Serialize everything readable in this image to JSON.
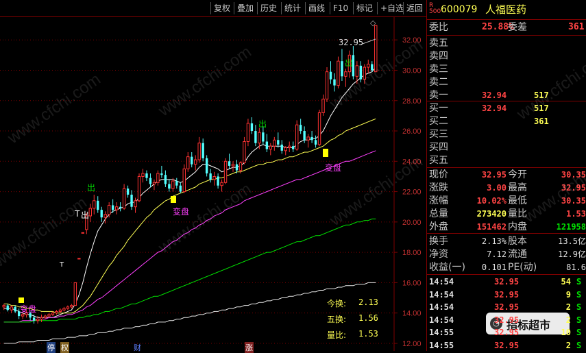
{
  "toolbar": {
    "buttons": [
      "复权",
      "叠加",
      "历史",
      "统计",
      "画线",
      "F10",
      "标记",
      "+自选",
      "返回"
    ]
  },
  "chart": {
    "y_ticks": [
      "32.00",
      "30.00",
      "28.00",
      "26.00",
      "24.00",
      "22.00",
      "20.00",
      "18.00",
      "16.00",
      "14.00",
      "12.00"
    ],
    "high_label": "32.95",
    "markers": {
      "chu1": "出",
      "chu2": "出",
      "chu3": "出",
      "chu4": "出",
      "biandian1": "变盘",
      "biandian2": "变盘",
      "biandian3": "变盘",
      "t_mark": "T"
    },
    "bottom_stats": {
      "jinhuan_label": "今换:",
      "jinhuan_value": "2.13",
      "wuhuan_label": "五换:",
      "wuhuan_value": "1.56",
      "liangbi_label": "量比:",
      "liangbi_value": "1.53"
    },
    "bottom_flags": [
      "停",
      "权",
      "财",
      "涨"
    ],
    "watermark": "www.cfchi.com"
  },
  "chart_data": {
    "type": "candlestick",
    "ylim": [
      11.5,
      33.5
    ],
    "candles": [
      [
        14.4,
        14.6,
        14.2,
        14.5
      ],
      [
        14.5,
        14.6,
        14.1,
        14.2
      ],
      [
        14.2,
        14.5,
        14.0,
        14.4
      ],
      [
        14.4,
        14.5,
        14.0,
        14.1
      ],
      [
        14.1,
        14.3,
        13.6,
        13.8
      ],
      [
        13.8,
        14.0,
        13.6,
        13.9
      ],
      [
        13.9,
        14.2,
        13.7,
        14.0
      ],
      [
        14.0,
        14.1,
        13.5,
        13.7
      ],
      [
        13.7,
        13.9,
        13.3,
        13.5
      ],
      [
        13.5,
        13.8,
        13.3,
        13.6
      ],
      [
        13.6,
        13.9,
        13.4,
        13.7
      ],
      [
        13.7,
        13.9,
        13.6,
        13.8
      ],
      [
        13.8,
        14.0,
        13.7,
        13.9
      ],
      [
        13.9,
        14.1,
        13.8,
        14.0
      ],
      [
        14.0,
        14.2,
        13.9,
        14.1
      ],
      [
        14.1,
        14.3,
        14.0,
        14.2
      ],
      [
        14.2,
        14.4,
        14.1,
        14.3
      ],
      [
        14.3,
        14.5,
        14.2,
        14.4
      ],
      [
        14.4,
        14.6,
        14.3,
        14.5
      ],
      [
        14.5,
        16.0,
        14.5,
        16.0
      ],
      [
        17.6,
        17.6,
        17.6,
        17.6
      ],
      [
        19.3,
        19.3,
        19.3,
        19.3
      ],
      [
        19.5,
        20.6,
        19.2,
        20.4
      ],
      [
        20.4,
        21.2,
        20.0,
        20.9
      ],
      [
        20.9,
        21.8,
        20.5,
        21.4
      ],
      [
        21.4,
        21.7,
        20.6,
        20.8
      ],
      [
        20.8,
        21.0,
        20.0,
        20.3
      ],
      [
        20.3,
        20.7,
        19.9,
        20.5
      ],
      [
        20.5,
        21.3,
        20.3,
        21.1
      ],
      [
        21.1,
        21.5,
        20.6,
        20.8
      ],
      [
        20.8,
        21.3,
        20.5,
        21.0
      ],
      [
        21.0,
        21.3,
        20.7,
        20.9
      ],
      [
        20.9,
        22.5,
        20.8,
        22.2
      ],
      [
        22.2,
        22.4,
        21.6,
        21.8
      ],
      [
        21.8,
        22.1,
        20.8,
        21.0
      ],
      [
        21.0,
        21.6,
        20.6,
        21.4
      ],
      [
        21.4,
        23.2,
        21.3,
        23.0
      ],
      [
        23.0,
        23.5,
        22.6,
        23.2
      ],
      [
        23.2,
        23.4,
        22.7,
        22.9
      ],
      [
        22.9,
        23.2,
        22.3,
        22.5
      ],
      [
        22.5,
        22.8,
        22.1,
        22.6
      ],
      [
        22.6,
        23.4,
        22.4,
        23.2
      ],
      [
        23.2,
        23.7,
        22.9,
        23.1
      ],
      [
        23.1,
        23.4,
        22.3,
        22.5
      ],
      [
        22.5,
        22.8,
        22.0,
        22.2
      ],
      [
        22.2,
        22.9,
        22.0,
        22.7
      ],
      [
        22.7,
        22.9,
        22.2,
        22.4
      ],
      [
        22.4,
        22.6,
        21.9,
        22.0
      ],
      [
        22.0,
        23.8,
        21.9,
        23.5
      ],
      [
        23.5,
        24.6,
        23.3,
        24.3
      ],
      [
        24.3,
        24.6,
        23.6,
        23.8
      ],
      [
        23.8,
        24.4,
        23.4,
        24.1
      ],
      [
        24.1,
        25.6,
        23.9,
        25.2
      ],
      [
        25.2,
        25.5,
        24.0,
        24.2
      ],
      [
        24.2,
        24.4,
        23.0,
        23.2
      ],
      [
        23.2,
        23.5,
        22.6,
        22.8
      ],
      [
        22.8,
        23.3,
        22.4,
        23.0
      ],
      [
        23.0,
        23.2,
        22.2,
        22.4
      ],
      [
        22.4,
        22.8,
        22.0,
        22.6
      ],
      [
        22.6,
        24.2,
        22.5,
        24.0
      ],
      [
        24.0,
        24.5,
        23.5,
        23.7
      ],
      [
        23.7,
        24.0,
        23.3,
        23.8
      ],
      [
        23.8,
        24.1,
        23.2,
        23.4
      ],
      [
        23.4,
        24.0,
        23.2,
        23.9
      ],
      [
        23.9,
        25.6,
        23.8,
        25.3
      ],
      [
        25.3,
        26.8,
        25.0,
        26.5
      ],
      [
        26.5,
        26.9,
        25.8,
        26.0
      ],
      [
        26.0,
        26.4,
        25.0,
        25.2
      ],
      [
        25.2,
        26.2,
        24.8,
        25.9
      ],
      [
        25.9,
        26.3,
        25.1,
        25.3
      ],
      [
        25.3,
        25.8,
        24.6,
        24.8
      ],
      [
        24.8,
        25.2,
        24.4,
        25.0
      ],
      [
        25.0,
        25.6,
        24.7,
        25.4
      ],
      [
        25.4,
        25.9,
        24.9,
        25.1
      ],
      [
        25.1,
        25.4,
        24.5,
        24.7
      ],
      [
        24.7,
        25.0,
        24.4,
        24.9
      ],
      [
        24.9,
        25.3,
        24.6,
        25.0
      ],
      [
        25.0,
        25.3,
        24.6,
        24.8
      ],
      [
        24.8,
        26.7,
        24.7,
        26.4
      ],
      [
        26.4,
        26.8,
        25.8,
        26.0
      ],
      [
        26.0,
        26.3,
        25.2,
        25.4
      ],
      [
        25.4,
        25.8,
        24.9,
        25.6
      ],
      [
        25.6,
        26.0,
        25.2,
        25.4
      ],
      [
        25.4,
        25.7,
        24.9,
        25.1
      ],
      [
        25.1,
        27.4,
        25.0,
        27.2
      ],
      [
        27.2,
        28.4,
        27.0,
        28.1
      ],
      [
        28.1,
        30.2,
        27.9,
        29.9
      ],
      [
        29.9,
        30.6,
        29.1,
        29.4
      ],
      [
        29.4,
        29.8,
        28.6,
        29.0
      ],
      [
        29.0,
        30.9,
        28.8,
        30.6
      ],
      [
        30.6,
        31.4,
        29.3,
        29.6
      ],
      [
        29.6,
        30.1,
        28.9,
        29.9
      ],
      [
        29.9,
        31.3,
        29.5,
        31.0
      ],
      [
        31.0,
        31.6,
        29.4,
        29.6
      ],
      [
        29.6,
        30.6,
        29.1,
        30.3
      ],
      [
        30.3,
        30.6,
        29.2,
        29.4
      ],
      [
        29.4,
        30.4,
        29.1,
        30.2
      ],
      [
        30.2,
        30.7,
        29.8,
        30.4
      ],
      [
        30.4,
        30.6,
        29.9,
        30.0
      ],
      [
        29.9,
        32.95,
        29.9,
        32.95
      ]
    ],
    "ma_lines": [
      {
        "color": "#ffffff",
        "values": [
          14.3,
          14.3,
          14.3,
          14.2,
          14.1,
          14.0,
          13.9,
          13.9,
          13.8,
          13.7,
          13.7,
          13.7,
          13.7,
          13.7,
          13.8,
          13.9,
          14.0,
          14.1,
          14.2,
          14.6,
          15.2,
          16.0,
          17.0,
          17.9,
          18.7,
          19.4,
          19.8,
          20.2,
          20.5,
          20.7,
          20.8,
          20.9,
          21.0,
          21.2,
          21.3,
          21.3,
          21.6,
          21.9,
          22.1,
          22.3,
          22.5,
          22.7,
          22.8,
          22.8,
          22.8,
          22.8,
          22.7,
          22.6,
          22.7,
          22.9,
          23.1,
          23.3,
          23.6,
          23.8,
          23.8,
          23.7,
          23.6,
          23.5,
          23.3,
          23.4,
          23.5,
          23.6,
          23.6,
          23.7,
          23.9,
          24.3,
          24.6,
          24.8,
          25.0,
          25.1,
          25.0,
          25.0,
          25.0,
          25.0,
          25.0,
          24.9,
          24.9,
          24.9,
          25.1,
          25.3,
          25.4,
          25.4,
          25.5,
          25.5,
          25.7,
          26.0,
          26.5,
          27.0,
          27.4,
          27.8,
          28.2,
          28.5,
          28.8,
          29.1,
          29.3,
          29.5,
          29.7,
          29.8,
          29.9,
          30.2
        ]
      },
      {
        "color": "#ffff54",
        "values": [
          14.6,
          14.6,
          14.5,
          14.5,
          14.4,
          14.4,
          14.3,
          14.3,
          14.2,
          14.2,
          14.1,
          14.1,
          14.1,
          14.1,
          14.0,
          14.0,
          14.0,
          14.0,
          14.0,
          14.1,
          14.3,
          14.5,
          14.8,
          15.1,
          15.5,
          15.9,
          16.3,
          16.7,
          17.1,
          17.4,
          17.8,
          18.1,
          18.4,
          18.8,
          19.1,
          19.4,
          19.7,
          20.0,
          20.3,
          20.5,
          20.8,
          21.0,
          21.2,
          21.4,
          21.5,
          21.7,
          21.8,
          21.9,
          22.0,
          22.1,
          22.2,
          22.3,
          22.5,
          22.6,
          22.7,
          22.8,
          22.8,
          22.9,
          22.9,
          23.0,
          23.1,
          23.2,
          23.3,
          23.3,
          23.4,
          23.5,
          23.6,
          23.7,
          23.8,
          23.8,
          23.9,
          23.9,
          24.0,
          24.1,
          24.1,
          24.2,
          24.3,
          24.3,
          24.4,
          24.5,
          24.6,
          24.6,
          24.7,
          24.8,
          24.9,
          25.0,
          25.2,
          25.4,
          25.5,
          25.7,
          25.8,
          26.0,
          26.1,
          26.2,
          26.3,
          26.4,
          26.5,
          26.6,
          26.7,
          26.8
        ]
      },
      {
        "color": "#ff40ff",
        "values": [
          13.4,
          13.4,
          13.4,
          13.4,
          13.4,
          13.5,
          13.5,
          13.5,
          13.5,
          13.6,
          13.6,
          13.6,
          13.7,
          13.7,
          13.7,
          13.8,
          13.8,
          13.9,
          13.9,
          14.0,
          14.1,
          14.2,
          14.4,
          14.5,
          14.7,
          14.9,
          15.0,
          15.2,
          15.4,
          15.6,
          15.8,
          16.0,
          16.2,
          16.4,
          16.6,
          16.8,
          17.0,
          17.2,
          17.4,
          17.6,
          17.8,
          18.0,
          18.1,
          18.3,
          18.5,
          18.7,
          18.8,
          19.0,
          19.2,
          19.3,
          19.5,
          19.6,
          19.8,
          19.9,
          20.1,
          20.2,
          20.4,
          20.5,
          20.6,
          20.8,
          20.9,
          21.0,
          21.1,
          21.2,
          21.4,
          21.5,
          21.6,
          21.7,
          21.8,
          21.9,
          22.0,
          22.1,
          22.2,
          22.3,
          22.4,
          22.5,
          22.6,
          22.7,
          22.8,
          22.8,
          22.9,
          23.0,
          23.1,
          23.2,
          23.3,
          23.4,
          23.5,
          23.6,
          23.7,
          23.8,
          23.9,
          24.0,
          24.0,
          24.1,
          24.2,
          24.3,
          24.4,
          24.5,
          24.6,
          24.7
        ]
      },
      {
        "color": "#00e000",
        "values": [
          13.4,
          13.4,
          13.4,
          13.4,
          13.4,
          13.4,
          13.4,
          13.4,
          13.5,
          13.5,
          13.5,
          13.5,
          13.5,
          13.5,
          13.5,
          13.6,
          13.6,
          13.6,
          13.6,
          13.6,
          13.7,
          13.7,
          13.8,
          13.8,
          13.9,
          13.9,
          14.0,
          14.1,
          14.1,
          14.2,
          14.3,
          14.3,
          14.4,
          14.5,
          14.6,
          14.6,
          14.7,
          14.8,
          14.9,
          15.0,
          15.1,
          15.1,
          15.2,
          15.3,
          15.4,
          15.5,
          15.6,
          15.7,
          15.8,
          15.9,
          16.0,
          16.1,
          16.2,
          16.3,
          16.4,
          16.5,
          16.6,
          16.7,
          16.8,
          16.9,
          17.0,
          17.1,
          17.2,
          17.3,
          17.4,
          17.5,
          17.6,
          17.7,
          17.8,
          17.9,
          18.0,
          18.0,
          18.1,
          18.2,
          18.3,
          18.4,
          18.5,
          18.6,
          18.7,
          18.7,
          18.8,
          18.9,
          19.0,
          19.1,
          19.1,
          19.2,
          19.3,
          19.4,
          19.5,
          19.6,
          19.7,
          19.8,
          19.8,
          19.9,
          20.0,
          20.0,
          20.1,
          20.1,
          20.2,
          20.2
        ]
      },
      {
        "color": "#e8e8e8",
        "values": [
          12.0,
          12.0,
          12.0,
          12.0,
          12.1,
          12.1,
          12.1,
          12.1,
          12.1,
          12.2,
          12.2,
          12.2,
          12.2,
          12.3,
          12.3,
          12.3,
          12.3,
          12.4,
          12.4,
          12.4,
          12.5,
          12.5,
          12.5,
          12.6,
          12.6,
          12.7,
          12.7,
          12.7,
          12.8,
          12.8,
          12.9,
          12.9,
          13.0,
          13.0,
          13.0,
          13.1,
          13.1,
          13.2,
          13.2,
          13.3,
          13.3,
          13.4,
          13.4,
          13.4,
          13.5,
          13.5,
          13.6,
          13.6,
          13.7,
          13.7,
          13.8,
          13.8,
          13.9,
          13.9,
          14.0,
          14.0,
          14.1,
          14.1,
          14.2,
          14.2,
          14.3,
          14.3,
          14.4,
          14.4,
          14.5,
          14.5,
          14.6,
          14.6,
          14.7,
          14.7,
          14.8,
          14.8,
          14.9,
          14.9,
          15.0,
          15.0,
          15.1,
          15.1,
          15.2,
          15.2,
          15.3,
          15.3,
          15.4,
          15.4,
          15.5,
          15.5,
          15.6,
          15.6,
          15.6,
          15.7,
          15.7,
          15.8,
          15.8,
          15.8,
          15.9,
          15.9,
          15.9,
          16.0,
          16.0,
          16.0
        ]
      }
    ]
  },
  "panel": {
    "stock_code": "600079",
    "stock_name": "人福医药",
    "badge_top": "R",
    "badge_bottom": "500",
    "weibi_label": "委比",
    "weibi_value": "25.88%",
    "weicha_label": "委差",
    "weicha_value": "361",
    "sell": [
      {
        "label": "卖五",
        "price": "",
        "vol": ""
      },
      {
        "label": "卖四",
        "price": "",
        "vol": ""
      },
      {
        "label": "卖三",
        "price": "",
        "vol": ""
      },
      {
        "label": "卖二",
        "price": "",
        "vol": ""
      },
      {
        "label": "卖一",
        "price": "32.94",
        "vol": "517"
      }
    ],
    "buy": [
      {
        "label": "买一",
        "price": "32.94",
        "vol": "517"
      },
      {
        "label": "买二",
        "price": "",
        "vol": "361"
      },
      {
        "label": "买三",
        "price": "",
        "vol": ""
      },
      {
        "label": "买四",
        "price": "",
        "vol": ""
      },
      {
        "label": "买五",
        "price": "",
        "vol": ""
      }
    ],
    "stats": [
      {
        "l1": "现价",
        "v1": "32.95",
        "c1": "red",
        "l2": "今开",
        "v2": "30.35",
        "c2": "red"
      },
      {
        "l1": "涨跌",
        "v1": "3.00",
        "c1": "red",
        "l2": "最高",
        "v2": "32.95",
        "c2": "red"
      },
      {
        "l1": "涨幅",
        "v1": "10.02%",
        "c1": "red",
        "l2": "最低",
        "v2": "30.35",
        "c2": "red"
      },
      {
        "l1": "总量",
        "v1": "273420",
        "c1": "yel",
        "l2": "量比",
        "v2": "1.53",
        "c2": "red"
      },
      {
        "l1": "外盘",
        "v1": "151462",
        "c1": "red",
        "l2": "内盘",
        "v2": "121958",
        "c2": "grn"
      }
    ],
    "fund": [
      {
        "l1": "换手",
        "v1": "2.13%",
        "l2": "股本",
        "v2": "13.5亿"
      },
      {
        "l1": "净资",
        "v1": "7.12",
        "l2": "流通",
        "v2": "12.9亿"
      },
      {
        "l1": "收益(一)",
        "v1": "0.101",
        "l2": "PE(动)",
        "v2": "81.6"
      }
    ],
    "ticks": [
      {
        "time": "14:54",
        "price": "32.95",
        "vol": "54",
        "side": "S"
      },
      {
        "time": "14:54",
        "price": "32.95",
        "vol": "9",
        "side": "S"
      },
      {
        "time": "14:54",
        "price": "32.95",
        "vol": "2",
        "side": "S"
      },
      {
        "time": "14:54",
        "price": "32.95",
        "vol": "2",
        "side": "S"
      },
      {
        "time": "14:55",
        "price": "32.95",
        "vol": "10",
        "side": "S"
      },
      {
        "time": "14:55",
        "price": "32.95",
        "vol": "2",
        "side": "S"
      }
    ],
    "overlay_badge": "指标超市",
    "watermark": "www.cfchi.com"
  },
  "colors": {
    "up": "#ff3232",
    "down": "#54ffff",
    "grid": "#800000",
    "axis_text": "#c03030"
  }
}
